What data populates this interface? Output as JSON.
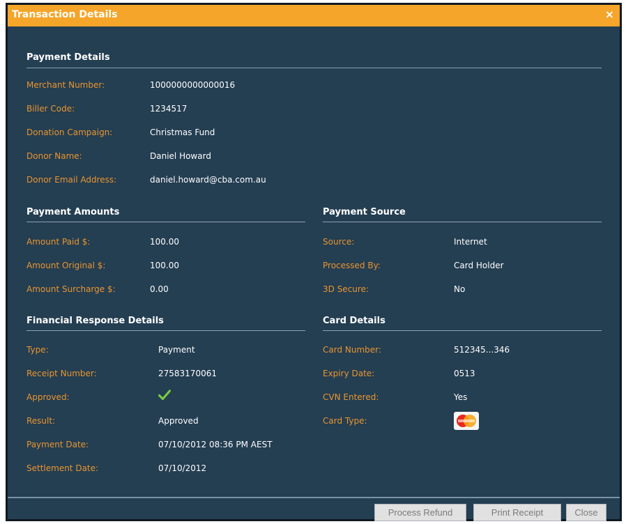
{
  "dialog": {
    "title": "Transaction Details",
    "close_glyph": "×"
  },
  "payment_details": {
    "title": "Payment Details",
    "merchant_number_label": "Merchant Number:",
    "merchant_number": "1000000000000016",
    "biller_code_label": "Biller Code:",
    "biller_code": "1234517",
    "donation_campaign_label": "Donation Campaign:",
    "donation_campaign": "Christmas Fund",
    "donor_name_label": "Donor Name:",
    "donor_name": "Daniel Howard",
    "donor_email_label": "Donor Email Address:",
    "donor_email": "daniel.howard@cba.com.au"
  },
  "payment_amounts": {
    "title": "Payment Amounts",
    "amount_paid_label": "Amount Paid $:",
    "amount_paid": "100.00",
    "amount_original_label": "Amount Original $:",
    "amount_original": "100.00",
    "amount_surcharge_label": "Amount Surcharge $:",
    "amount_surcharge": "0.00"
  },
  "payment_source": {
    "title": "Payment Source",
    "source_label": "Source:",
    "source": "Internet",
    "processed_by_label": "Processed By:",
    "processed_by": "Card Holder",
    "secure_3d_label": "3D Secure:",
    "secure_3d": "No"
  },
  "financial_response": {
    "title": "Financial Response Details",
    "type_label": "Type:",
    "type": "Payment",
    "receipt_number_label": "Receipt Number:",
    "receipt_number": "27583170061",
    "approved_label": "Approved:",
    "approved_icon": "check-icon",
    "result_label": "Result:",
    "result": "Approved",
    "payment_date_label": "Payment Date:",
    "payment_date": "07/10/2012 08:36 PM AEST",
    "settlement_date_label": "Settlement Date:",
    "settlement_date": "07/10/2012"
  },
  "card_details": {
    "title": "Card Details",
    "card_number_label": "Card Number:",
    "card_number": "512345...346",
    "expiry_date_label": "Expiry Date:",
    "expiry_date": "0513",
    "cvn_entered_label": "CVN Entered:",
    "cvn_entered": "Yes",
    "card_type_label": "Card Type:",
    "card_type_icon": "mastercard-icon"
  },
  "buttons": {
    "process_refund": "Process Refund",
    "print_receipt": "Print Receipt",
    "close": "Close"
  },
  "colors": {
    "background": "#243e52",
    "titlebar": "#f5a529",
    "label": "#e9962f",
    "value": "#ffffff",
    "check": "#7ac943"
  }
}
